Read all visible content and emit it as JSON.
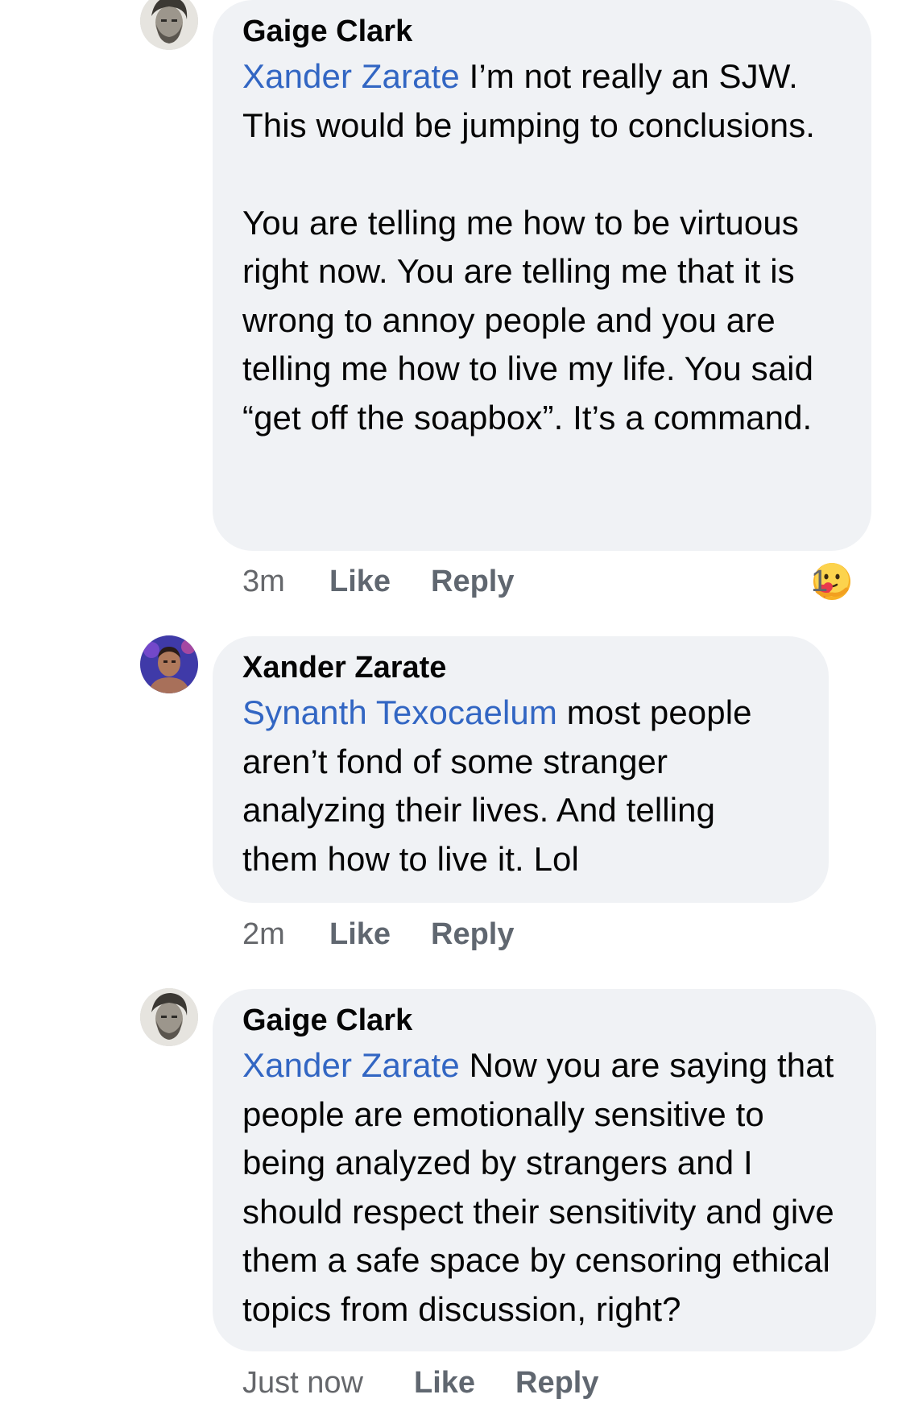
{
  "comments": [
    {
      "author": "Gaige Clark",
      "mention": "Xander Zarate",
      "text": " I’m not really an SJW. This would be jumping to conclusions.\n\nYou are telling me how to be virtuous right now. You are telling me that it is wrong to annoy people and you are telling me how to live my life. You said “get off the soapbox”. It’s a command.",
      "time": "3m",
      "like_label": "Like",
      "reply_label": "Reply",
      "reaction_count": "1",
      "reaction_icon": "care-emoji-icon"
    },
    {
      "author": "Xander Zarate",
      "mention": "Synanth Texocaelum",
      "text": " most people aren’t fond of some stranger analyzing their lives. And telling them how to live it. Lol",
      "time": "2m",
      "like_label": "Like",
      "reply_label": "Reply"
    },
    {
      "author": "Gaige Clark",
      "mention": "Xander Zarate",
      "text": " Now you are saying that people are emotionally sensitive to being analyzed by strangers and I should respect their sensitivity and give them a safe space by censoring ethical topics from discussion, right?",
      "time": "Just now",
      "like_label": "Like",
      "reply_label": "Reply"
    }
  ],
  "colors": {
    "bubble": "#f0f2f5",
    "mention": "#3266c3",
    "meta": "#65676b"
  }
}
